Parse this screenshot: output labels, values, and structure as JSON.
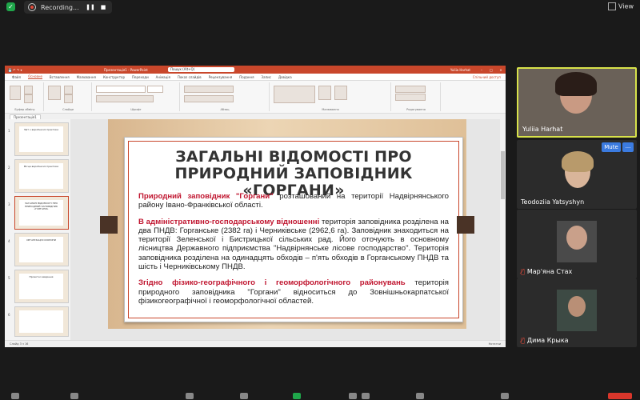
{
  "topbar": {
    "recording_label": "Recording...",
    "pause_label": "❚❚",
    "stop_label": "■",
    "view_label": "View"
  },
  "powerpoint": {
    "window_title": "Презентація1 - PowerPoint",
    "search_placeholder": "Пошук (Alt+Q)",
    "user_name": "Yuliia Harhat",
    "menu": [
      "Файл",
      "Основне",
      "Вставлення",
      "Малювання",
      "Конструктор",
      "Переходи",
      "Анімація",
      "Показ слайдів",
      "Рецензування",
      "Подання",
      "Запис",
      "Довідка"
    ],
    "menu_active": "Основне",
    "share_label": "Спільний доступ",
    "file_tab": "Презентація1",
    "ribbon_groups": [
      "Буфер обміну",
      "Слайди",
      "Шрифт",
      "Абзац",
      "Малювання",
      "Редагування"
    ],
    "thumbnails": [
      {
        "num": "1",
        "text": "Звіт з виробничої практики"
      },
      {
        "num": "2",
        "text": "Місце виробничої практики"
      },
      {
        "num": "3",
        "text": "ЗАГАЛЬНІ ВІДОМОСТІ ПРО ПРИРОДНИЙ ЗАПОВІДНИК «ГОРГАНИ»"
      },
      {
        "num": "4",
        "text": "ОРГАНІЗАЦІЯ ОХОРОНИ"
      },
      {
        "num": "5",
        "text": "Проектні завдання"
      },
      {
        "num": "6",
        "text": ""
      }
    ],
    "status_left": "Слайд 3 з 16",
    "status_right": "Нотатки",
    "slide": {
      "title": "ЗАГАЛЬНІ ВІДОМОСТІ ПРО ПРИРОДНИЙ ЗАПОВІДНИК «ГОРГАНИ»",
      "p1_red": "Природний заповідник \"Горгани\"",
      "p1_rest": " розташований на території Надвірнянського району Івано-Франківської області.",
      "p2_red": "В адміністративно-господарському відношенні",
      "p2_rest": " територія заповідника розділена на два ПНДВ: Горганське (2382 га) і Черниківське (2962,6 га). Заповідник знаходиться на території Зеленської і Бистрицької сільських рад. Його оточують в основному лісництва Державного підприємства \"Надвірнянське лісове господарство\". Територія заповідника розділена на одинадцять обходів – п'ять обходів в Горганському ПНДВ та шість і Черниківському ПНДВ.",
      "p3_red": "Згідно фізико-географічного і геоморфологічного районувань",
      "p3_rest": " територія природного заповідника \"Горгани\" відноситься до Зовнішньокарпатської фізикогеографічної і геоморфологічної областей."
    }
  },
  "participants": [
    {
      "name": "Yuliia Harhat",
      "muted": false
    },
    {
      "name": "Teodoziia Yatsyshyn",
      "muted": false
    },
    {
      "name": "Мар'яна Стах",
      "muted": true
    },
    {
      "name": "Дима Крыка",
      "muted": true
    }
  ],
  "participant_actions": {
    "mute_label": "Mute",
    "more_label": "..."
  },
  "colors": {
    "accent": "#c9472b",
    "slide_red": "#c0152f",
    "speaker_border": "#d8e24a",
    "mute_blue": "#3b7be0"
  }
}
